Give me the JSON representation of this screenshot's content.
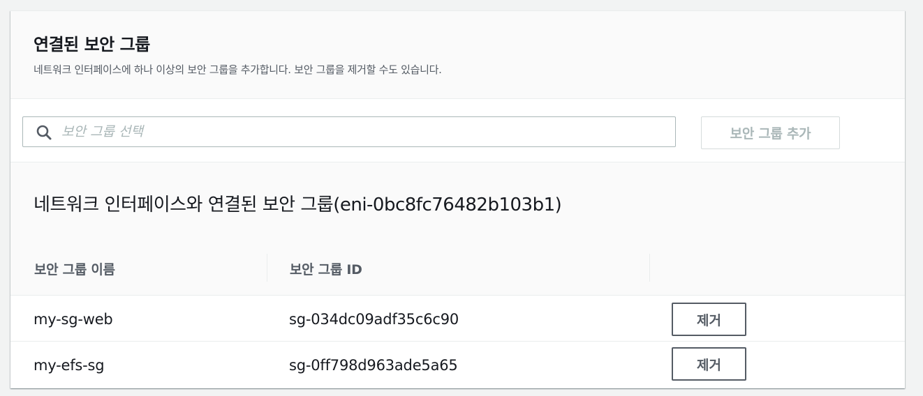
{
  "panel": {
    "title": "연결된 보안 그룹",
    "description": "네트워크 인터페이스에 하나 이상의 보안 그룹을 추가합니다. 보안 그룹을 제거할 수도 있습니다."
  },
  "search": {
    "placeholder": "보안 그룹 선택",
    "value": "",
    "icon": "search-icon"
  },
  "add_button_label": "보안 그룹 추가",
  "associated": {
    "title": "네트워크 인터페이스와 연결된 보안 그룹(eni-0bc8fc76482b103b1)"
  },
  "table": {
    "columns": [
      "보안 그룹 이름",
      "보안 그룹 ID",
      ""
    ],
    "rows": [
      {
        "name": "my-sg-web",
        "id": "sg-034dc09adf35c6c90",
        "action": "제거"
      },
      {
        "name": "my-efs-sg",
        "id": "sg-0ff798d963ade5a65",
        "action": "제거"
      }
    ]
  },
  "colors": {
    "text_primary": "#16191f",
    "text_secondary": "#545b64",
    "disabled": "#aab7b8",
    "border": "#eaeded",
    "header_bg": "#fafafa"
  }
}
